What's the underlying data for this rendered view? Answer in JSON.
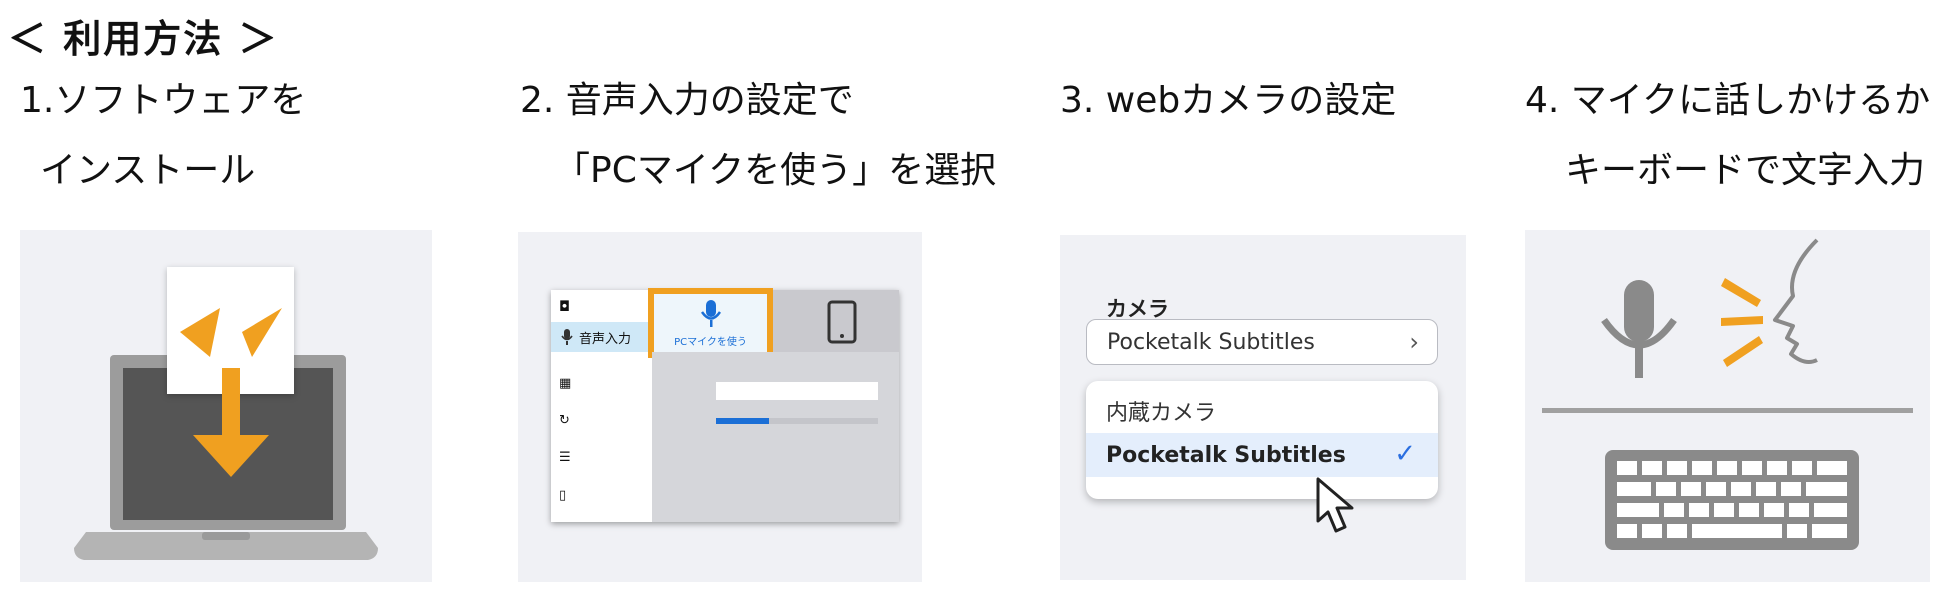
{
  "page_title": "＜ 利用方法 ＞",
  "steps": [
    {
      "line1": "1.ソフトウェアを",
      "line2": "インストール"
    },
    {
      "line1": "2. 音声入力の設定で",
      "line2": "「PCマイクを使う」を選択"
    },
    {
      "line1": "3. webカメラの設定",
      "line2": ""
    },
    {
      "line1": "4. マイクに話しかけるか",
      "line2": "キーボードで文字入力"
    }
  ],
  "panel2": {
    "side_items": [
      "",
      "音声入力",
      "",
      "",
      "",
      ""
    ],
    "pc_mic_label": "PCマイクを使う",
    "mic_level": 0.33
  },
  "panel3": {
    "camera_label": "カメラ",
    "selected_device": "Pocketalk Subtitles",
    "options": [
      "内蔵カメラ",
      "Pocketalk Subtitles"
    ],
    "selected_index": 1
  },
  "colors": {
    "accent_orange": "#f0a020",
    "panel_bg": "#f0f1f5",
    "device_gray": "#8c8c8c",
    "blue": "#1b6fd6"
  },
  "icons": [
    "download-arrow-icon",
    "laptop-icon",
    "microphone-icon",
    "smartphone-icon",
    "camera-icon",
    "check-icon",
    "cursor-icon",
    "speaking-face-icon",
    "keyboard-icon"
  ]
}
